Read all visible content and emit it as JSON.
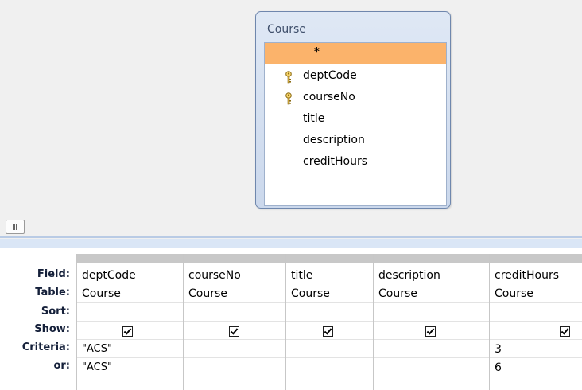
{
  "diagram": {
    "table_name": "Course",
    "fields": [
      {
        "name": "*",
        "key": false,
        "selected": true
      },
      {
        "name": "deptCode",
        "key": true,
        "selected": false
      },
      {
        "name": "courseNo",
        "key": true,
        "selected": false
      },
      {
        "name": "title",
        "key": false,
        "selected": false
      },
      {
        "name": "description",
        "key": false,
        "selected": false
      },
      {
        "name": "creditHours",
        "key": false,
        "selected": false
      }
    ]
  },
  "grid": {
    "row_labels": {
      "field": "Field:",
      "table": "Table:",
      "sort": "Sort:",
      "show": "Show:",
      "criteria": "Criteria:",
      "or": "or:"
    },
    "columns": [
      {
        "field": "deptCode",
        "table": "Course",
        "sort": "",
        "show": true,
        "criteria": "\"ACS\"",
        "or": "\"ACS\""
      },
      {
        "field": "courseNo",
        "table": "Course",
        "sort": "",
        "show": true,
        "criteria": "",
        "or": ""
      },
      {
        "field": "title",
        "table": "Course",
        "sort": "",
        "show": true,
        "criteria": "",
        "or": ""
      },
      {
        "field": "description",
        "table": "Course",
        "sort": "",
        "show": true,
        "criteria": "",
        "or": ""
      },
      {
        "field": "creditHours",
        "table": "Course",
        "sort": "",
        "show": true,
        "criteria": "3",
        "or": "6"
      }
    ]
  },
  "colors": {
    "selected_field": "#fbb36b",
    "table_border": "#6f87ad",
    "grid_band": "#dae6f6"
  }
}
